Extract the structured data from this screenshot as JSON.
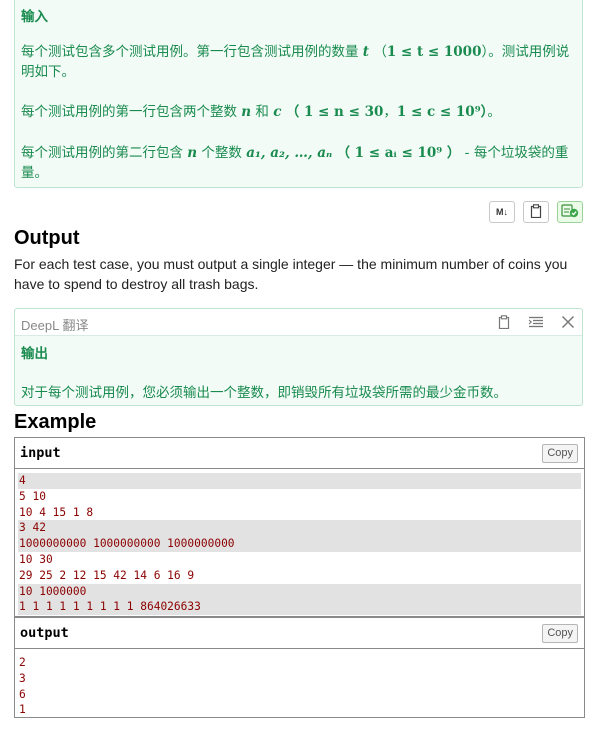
{
  "input_translation": {
    "heading": "输入",
    "p1_a": "每个测试包含多个测试用例。第一行包含测试用例的数量",
    "p1_var": "t",
    "p1_paren_open": "（",
    "p1_math": "1 ≤ t ≤ 1000",
    "p1_b": "）。测试用例说明如下。",
    "p2_a": "每个测试用例的第一行包含两个整数",
    "p2_n": "n",
    "p2_and": "和",
    "p2_c": "c",
    "p2_math1": "（ 1 ≤ n ≤ 30",
    "p2_comma": "，",
    "p2_math2": "1 ≤ c ≤ 10⁹）",
    "p2_end": "。",
    "p3_a": "每个测试用例的第二行包含",
    "p3_n": "n",
    "p3_b": "个整数",
    "p3_seq": "a₁, a₂, …, aₙ",
    "p3_math": "（ 1 ≤ aᵢ ≤ 10⁹ ）",
    "p3_c": "- 每个垃圾袋的重量。"
  },
  "toolbar": {
    "markdown_label": "M↓",
    "clipboard_icon": "clipboard-icon",
    "translate_icon": "translate-check-icon"
  },
  "output_section": {
    "heading": "Output",
    "text": "For each test case, you must output a single integer — the minimum number of coins you have to spend to destroy all trash bags."
  },
  "deepl": {
    "label": "DeepL 翻译",
    "heading": "输出",
    "text": "对于每个测试用例，您必须输出一个整数，即销毁所有垃圾袋所需的最少金币数。"
  },
  "example": {
    "heading": "Example",
    "input_title": "input",
    "output_title": "output",
    "copy_label": "Copy",
    "input_lines": [
      "4",
      "5 10",
      "10 4 15 1 8",
      "3 42",
      "1000000000 1000000000 1000000000",
      "10 30",
      "29 25 2 12 15 42 14 6 16 9",
      "10 1000000",
      "1 1 1 1 1 1 1 1 1 864026633"
    ],
    "input_shade": [
      true,
      false,
      false,
      true,
      true,
      false,
      false,
      true,
      true
    ],
    "output_lines": [
      "2",
      "3",
      "6",
      "1"
    ]
  },
  "colors": {
    "translation_green": "#1a8b4f",
    "translation_bg": "#f2fbf6",
    "code_text": "#8b0000",
    "stripe": "#e2e2e2"
  }
}
